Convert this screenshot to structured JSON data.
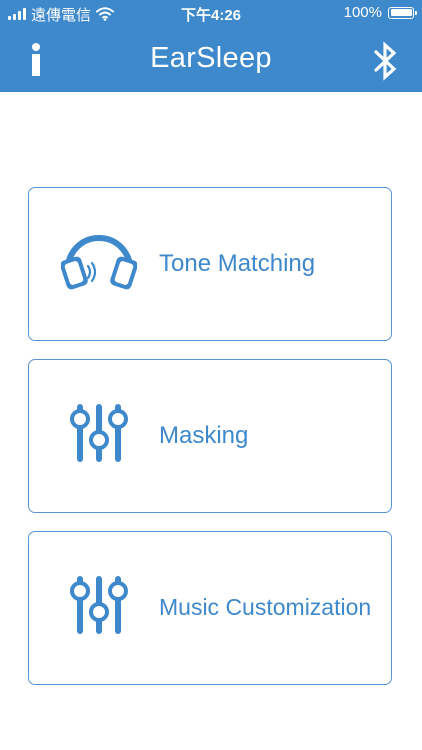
{
  "status_bar": {
    "carrier": "遠傳電信",
    "time": "下午4:26",
    "battery_percent": "100%",
    "battery_level": 1.0
  },
  "nav": {
    "title": "EarSleep",
    "info_icon": "info-icon",
    "bluetooth_icon": "bluetooth-icon"
  },
  "menu": {
    "items": [
      {
        "label": "Tone Matching",
        "icon": "headphones-icon"
      },
      {
        "label": "Masking",
        "icon": "equalizer-sliders-icon"
      },
      {
        "label": "Music Customization",
        "icon": "equalizer-sliders-icon"
      }
    ]
  },
  "colors": {
    "accent": "#3e88cc",
    "card_border": "#5a96d0",
    "background": "#ffffff"
  }
}
